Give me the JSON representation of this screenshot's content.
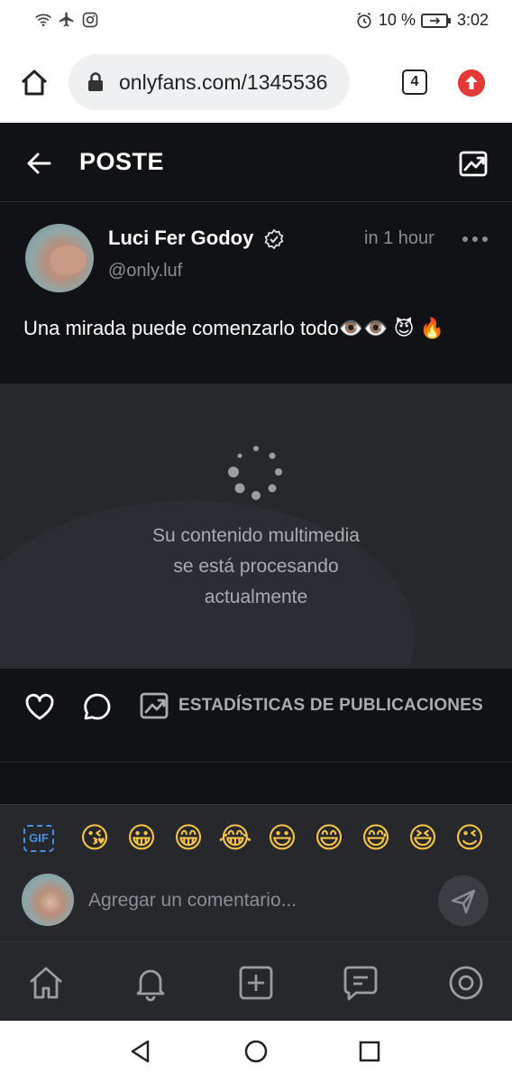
{
  "status_bar": {
    "battery": "10 %",
    "time": "3:02",
    "icons": [
      "wifi-icon",
      "airplane-icon",
      "instagram-icon",
      "alarm-icon",
      "battery-icon"
    ]
  },
  "browser": {
    "url": "onlyfans.com/1345536",
    "tab_count": "4"
  },
  "header": {
    "title": "POSTE"
  },
  "post": {
    "author_name": "Luci Fer Godoy",
    "username": "@only.luf",
    "time": "in 1 hour",
    "text": "Una mirada puede comenzarlo todo👁️👁️ 😈 🔥",
    "processing_line1": "Su contenido multimedia",
    "processing_line2": "se está procesando",
    "processing_line3": "actualmente"
  },
  "actions": {
    "stats_label": "ESTADÍSTICAS DE PUBLICACIONES"
  },
  "composer": {
    "gif_label": "GIF",
    "emojis": [
      "😘",
      "😀",
      "😁",
      "😂",
      "😃",
      "😄",
      "😅",
      "😆",
      "😉"
    ],
    "placeholder": "Agregar un comentario..."
  },
  "bottom_nav": {
    "items": [
      "home-icon",
      "bell-icon",
      "plus-square-icon",
      "messages-icon",
      "profile-icon"
    ]
  },
  "colors": {
    "background": "#111215",
    "panel": "#26282c",
    "muted_text": "#8a8d93",
    "accent_blue": "#4a90e2",
    "update_red": "#e53935"
  }
}
